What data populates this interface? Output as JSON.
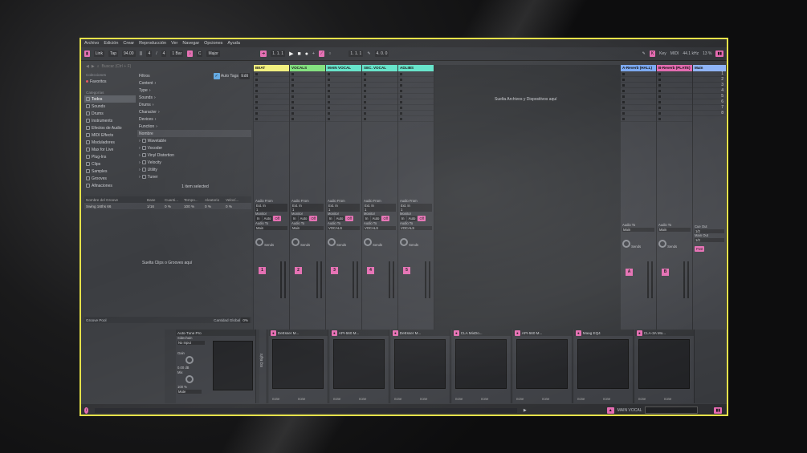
{
  "menu": [
    "Archivo",
    "Edición",
    "Crear",
    "Reproducción",
    "Ver",
    "Navegar",
    "Opciones",
    "Ayuda"
  ],
  "toolbar": {
    "link": "Link",
    "tap": "Tap",
    "tempo": "94.00",
    "timesig_num": "4",
    "timesig_den": "4",
    "quant": "1 Bar",
    "key": "C",
    "scale": "Major",
    "position": "1.  1.  1",
    "loop_start": "1.  1.  1",
    "loop_len": "4.  0.  0",
    "key_label": "Key",
    "midi_label": "MIDI",
    "sample_rate": "44.1 kHz",
    "cpu": "13 %"
  },
  "browser": {
    "search_placeholder": "Buscar (Ctrl + F)",
    "collections_title": "Colecciones",
    "favorites": "Favoritos",
    "categories_title": "Categorías",
    "categories": [
      "Todos",
      "Sounds",
      "Drums",
      "Instruments",
      "Efectos de Audio",
      "MIDI Effects",
      "Moduladores",
      "Max for Live",
      "Plug-Ins",
      "Clips",
      "Samples",
      "Grooves",
      "Afinaciones"
    ],
    "filters_label": "Filtros",
    "autotags_label": "Auto Tags",
    "edit_label": "Edit",
    "filter_items": [
      "Content",
      "Type",
      "Sounds",
      "Drums",
      "Character",
      "Devices",
      "Function"
    ],
    "name_col": "Nombre",
    "results": [
      "Wavetable",
      "Vocoder",
      "Vinyl Distortion",
      "Velocity",
      "Utility",
      "Tuner"
    ],
    "selection_status": "1 item selected"
  },
  "groove": {
    "headers": [
      "Nombre del Groove",
      "Base",
      "Cuanti...",
      "Tempo...",
      "Aleatorio",
      "Velocí..."
    ],
    "row": [
      "Swing 16ths 66",
      "1/16",
      "0 %",
      "100 %",
      "0 %",
      "0 %"
    ],
    "drop_text": "Suelta Clips o Grooves aquí",
    "pool_label": "Groove Pool",
    "global_amount_label": "Cantidad Global",
    "global_amount": "0%"
  },
  "session": {
    "drop_text": "Suelta Archivos y Dispositivos aquí",
    "tracks": [
      {
        "name": "BEAT",
        "color": "#f2f07a",
        "num": "1"
      },
      {
        "name": "VOCALS",
        "color": "#7ee07a",
        "num": "2"
      },
      {
        "name": "MAIN VOCAL",
        "color": "#5fe3c8",
        "num": "3"
      },
      {
        "name": "SEC. VOCAL",
        "color": "#5fe3c8",
        "num": "4"
      },
      {
        "name": "ADLIBS",
        "color": "#5fe3c8",
        "num": "5"
      }
    ],
    "returns": [
      {
        "name": "A-Reverb (HALL)",
        "color": "#7aa8f2",
        "num": "A"
      },
      {
        "name": "B-Reverb (PLATE)",
        "color": "#e46ab0",
        "num": "B"
      }
    ],
    "main": {
      "name": "Main",
      "color": "#8fb4f5"
    },
    "scene_numbers": [
      "1",
      "2",
      "3",
      "4",
      "5",
      "6",
      "7",
      "8"
    ],
    "audio_from": "Audio From",
    "ext_in": "Ext. In",
    "monitor": "Monitor",
    "in": "In",
    "auto": "Auto",
    "off": "Off",
    "audio_to": "Audio To",
    "main_dest": "Main",
    "vocals_dest": "VOCALS",
    "sends": "Sends",
    "cue_out": "Cue Out",
    "main_out": "Main Out",
    "half": "1/2",
    "post": "Post",
    "meter_ticks": [
      "0",
      "12",
      "24",
      "36",
      "48",
      "60"
    ]
  },
  "devices": [
    {
      "name": "Auto-Tune Pro",
      "sidechain": "Sidechain",
      "no_input": "No Input",
      "gain": "Gain",
      "gain_value": "0.00 dB",
      "mix": "Mix",
      "mix_value": "100 %",
      "mute": "Mute"
    },
    {
      "name": "DeEsser M..."
    },
    {
      "name": "API-560 M..."
    },
    {
      "name": "DeEsser M..."
    },
    {
      "name": "CLA MixDo..."
    },
    {
      "name": "API-560 M..."
    },
    {
      "name": "Maag EQ4"
    },
    {
      "name": "CLA-3A Mo..."
    }
  ],
  "eq_label": "EQ Eight",
  "none": "none",
  "status": {
    "track_name": "MAIN VOCAL"
  },
  "colors": {
    "accent": "#e46ab0",
    "highlight": "#e6e24a"
  }
}
